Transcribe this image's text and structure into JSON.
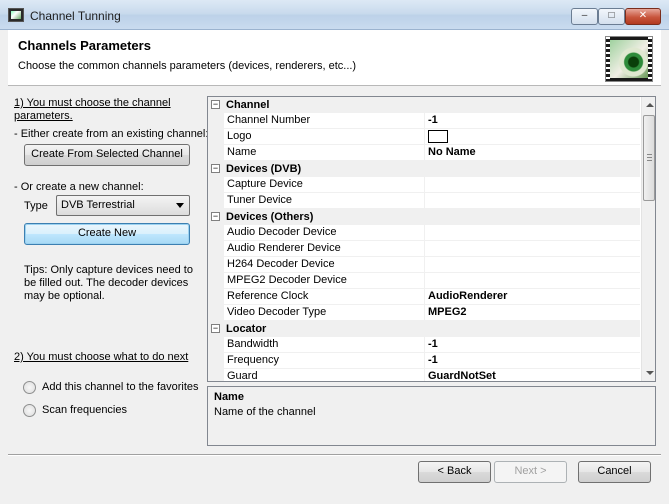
{
  "window": {
    "title": "Channel Tunning",
    "min_glyph": "–",
    "max_glyph": "□",
    "close_glyph": "✕"
  },
  "header": {
    "title": "Channels Parameters",
    "subtitle": "Choose the common channels parameters (devices, renderers, etc...)"
  },
  "left": {
    "step1_line1": "1) You must choose the channel",
    "step1_line2": "parameters.",
    "existing_label": "- Either create from an existing channel:",
    "create_from_selected_label": "Create From Selected Channel",
    "new_label": "- Or create a new channel:",
    "type_label": "Type",
    "type_value": "DVB Terrestrial",
    "create_new_label": "Create New",
    "tips_line1": "Tips: Only capture devices need to",
    "tips_line2": "be filled out. The decoder devices",
    "tips_line3": "may be optional.",
    "step2": "2) You must choose what to do next",
    "radio_favorites": "Add this channel to the favorites",
    "radio_scan": "Scan frequencies"
  },
  "grid": {
    "rows": [
      {
        "kind": "cat",
        "label": "Channel"
      },
      {
        "kind": "prop",
        "name": "Channel Number",
        "value": "-1"
      },
      {
        "kind": "prop",
        "name": "Logo",
        "value": "",
        "logo": true
      },
      {
        "kind": "prop",
        "name": "Name",
        "value": "No Name"
      },
      {
        "kind": "cat",
        "label": "Devices (DVB)"
      },
      {
        "kind": "prop",
        "name": "Capture Device",
        "value": ""
      },
      {
        "kind": "prop",
        "name": "Tuner Device",
        "value": ""
      },
      {
        "kind": "cat",
        "label": "Devices (Others)"
      },
      {
        "kind": "prop",
        "name": "Audio Decoder Device",
        "value": ""
      },
      {
        "kind": "prop",
        "name": "Audio Renderer Device",
        "value": ""
      },
      {
        "kind": "prop",
        "name": "H264 Decoder Device",
        "value": ""
      },
      {
        "kind": "prop",
        "name": "MPEG2 Decoder Device",
        "value": ""
      },
      {
        "kind": "prop",
        "name": "Reference Clock",
        "value": "AudioRenderer"
      },
      {
        "kind": "prop",
        "name": "Video Decoder Type",
        "value": "MPEG2"
      },
      {
        "kind": "cat",
        "label": "Locator"
      },
      {
        "kind": "prop",
        "name": "Bandwidth",
        "value": "-1"
      },
      {
        "kind": "prop",
        "name": "Frequency",
        "value": "-1"
      },
      {
        "kind": "prop",
        "name": "Guard",
        "value": "GuardNotSet"
      }
    ],
    "collapse_glyph": "−"
  },
  "description": {
    "title": "Name",
    "text": "Name of the channel"
  },
  "footer": {
    "back_label": "< Back",
    "next_label": "Next >",
    "cancel_label": "Cancel"
  }
}
